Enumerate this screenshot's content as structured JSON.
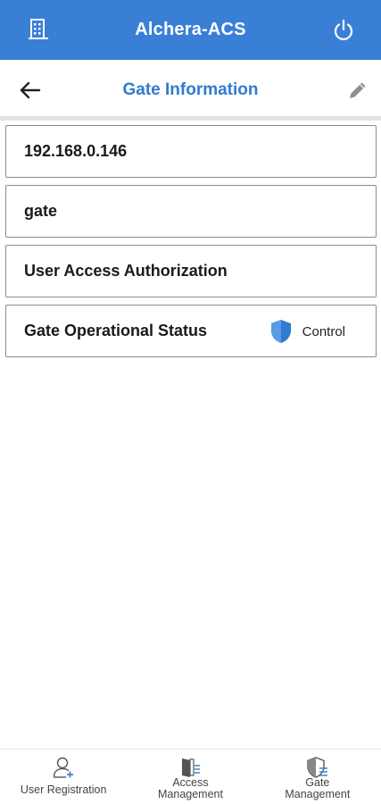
{
  "app": {
    "title": "Alchera-ACS",
    "left_icon": "building-icon",
    "right_icon": "power-icon",
    "bar_color": "#3a7fd6"
  },
  "header": {
    "title": "Gate Information",
    "back_icon": "arrow-left-icon",
    "edit_icon": "pencil-icon",
    "title_color": "#2f7bd0"
  },
  "fields": [
    {
      "value": "192.168.0.146"
    },
    {
      "value": "gate"
    },
    {
      "value": "User Access Authorization"
    },
    {
      "value": "Gate Operational Status",
      "action_label": "Control",
      "action_icon": "shield-icon",
      "action_color": "#2f7bd0"
    }
  ],
  "bottom_nav": [
    {
      "label": "User Registration",
      "icon": "user-add-icon"
    },
    {
      "label_line1": "Access",
      "label_line2": "Management",
      "icon": "door-list-icon"
    },
    {
      "label_line1": "Gate",
      "label_line2": "Management",
      "icon": "shield-list-icon"
    }
  ]
}
